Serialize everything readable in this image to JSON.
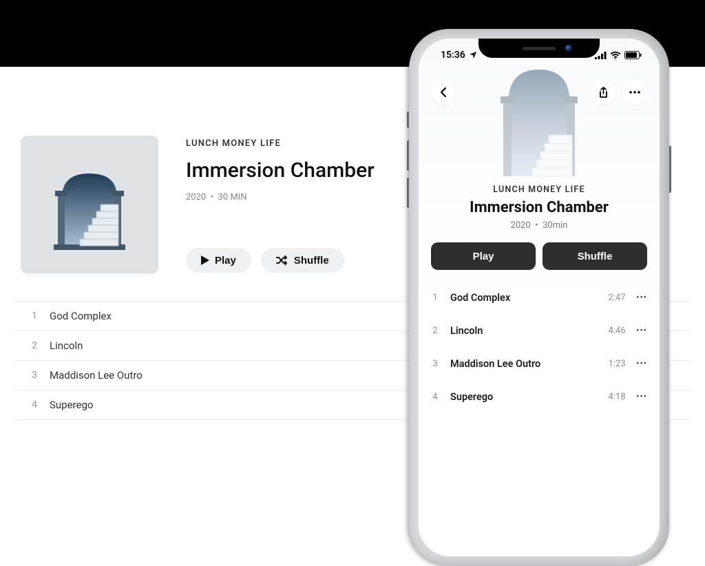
{
  "album": {
    "artist": "LUNCH MONEY LIFE",
    "title": "Immersion Chamber",
    "year": "2020",
    "duration_desktop": "30 MIN",
    "duration_mobile": "30min",
    "play_label": "Play",
    "shuffle_label": "Shuffle"
  },
  "tracks": [
    {
      "n": "1",
      "title": "God Complex",
      "duration": "2:47"
    },
    {
      "n": "2",
      "title": "Lincoln",
      "duration": "4:46"
    },
    {
      "n": "3",
      "title": "Maddison Lee Outro",
      "duration": "1:23"
    },
    {
      "n": "4",
      "title": "Superego",
      "duration": "4:18"
    }
  ],
  "phone": {
    "time": "15:36"
  }
}
